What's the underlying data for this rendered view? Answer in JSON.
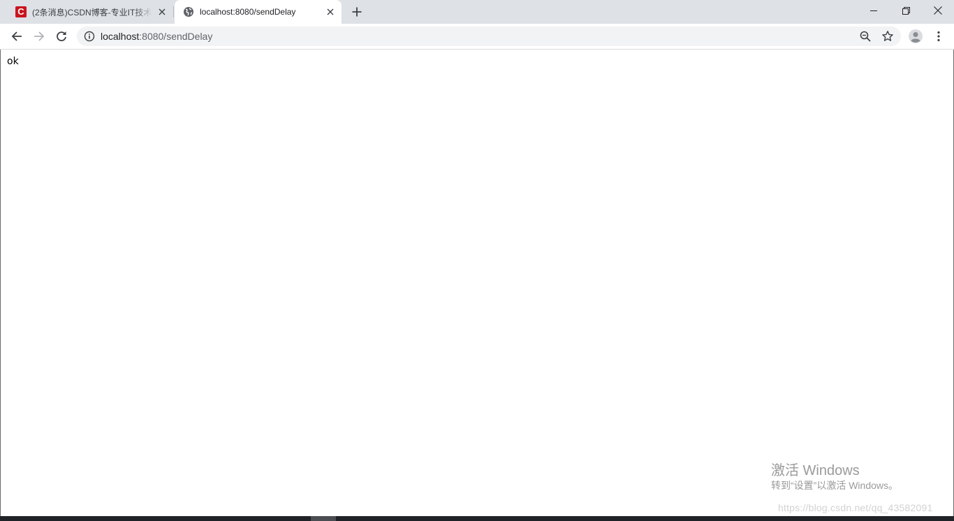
{
  "browser": {
    "tabs": [
      {
        "title": "(2条消息)CSDN博客-专业IT技术",
        "favicon": "csdn-logo-icon",
        "active": false
      },
      {
        "title": "localhost:8080/sendDelay",
        "favicon": "globe-icon",
        "active": true
      }
    ],
    "address_bar": {
      "host": "localhost",
      "rest": ":8080/sendDelay"
    }
  },
  "page": {
    "body_text": "ok"
  },
  "overlay": {
    "activate_title": "激活 Windows",
    "activate_subtitle": "转到“设置”以激活 Windows。",
    "watermark": "https://blog.csdn.net/qq_43582091"
  },
  "colors": {
    "tabstrip_bg": "#dee1e6",
    "omnibox_bg": "#f1f3f4",
    "csdn_red": "#c9151e",
    "icon_gray": "#5f6368"
  }
}
